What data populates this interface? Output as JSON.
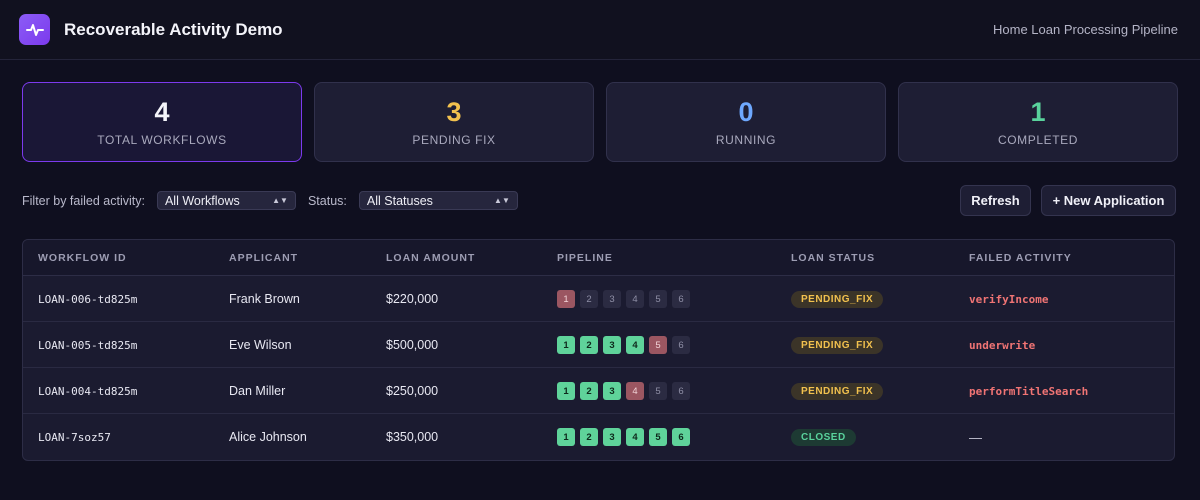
{
  "header": {
    "title": "Recoverable Activity Demo",
    "subtitle": "Home Loan Processing Pipeline",
    "logo_icon": "activity-pulse-icon"
  },
  "stats": [
    {
      "value": "4",
      "label": "TOTAL WORKFLOWS",
      "color": "#f4f4fa"
    },
    {
      "value": "3",
      "label": "PENDING FIX",
      "color": "#f2c14e"
    },
    {
      "value": "0",
      "label": "RUNNING",
      "color": "#6ea8fe"
    },
    {
      "value": "1",
      "label": "COMPLETED",
      "color": "#59d29c"
    }
  ],
  "filters": {
    "failed_label": "Filter by failed activity:",
    "failed_value": "All Workflows",
    "status_label": "Status:",
    "status_value": "All Statuses",
    "refresh": "Refresh",
    "new_application": "+ New Application"
  },
  "table": {
    "columns": [
      "WORKFLOW ID",
      "APPLICANT",
      "LOAN AMOUNT",
      "PIPELINE",
      "LOAN STATUS",
      "FAILED ACTIVITY"
    ],
    "rows": [
      {
        "id": "LOAN-006-td825m",
        "applicant": "Frank Brown",
        "amount": "$220,000",
        "pipeline": [
          "fail",
          "todo",
          "todo",
          "todo",
          "todo",
          "todo"
        ],
        "status": "PENDING_FIX",
        "status_kind": "pending",
        "failed": "verifyIncome"
      },
      {
        "id": "LOAN-005-td825m",
        "applicant": "Eve Wilson",
        "amount": "$500,000",
        "pipeline": [
          "done",
          "done",
          "done",
          "done",
          "fail",
          "todo"
        ],
        "status": "PENDING_FIX",
        "status_kind": "pending",
        "failed": "underwrite"
      },
      {
        "id": "LOAN-004-td825m",
        "applicant": "Dan Miller",
        "amount": "$250,000",
        "pipeline": [
          "done",
          "done",
          "done",
          "fail",
          "todo",
          "todo"
        ],
        "status": "PENDING_FIX",
        "status_kind": "pending",
        "failed": "performTitleSearch"
      },
      {
        "id": "LOAN-7soz57",
        "applicant": "Alice Johnson",
        "amount": "$350,000",
        "pipeline": [
          "done",
          "done",
          "done",
          "done",
          "done",
          "done"
        ],
        "status": "CLOSED",
        "status_kind": "closed",
        "failed": "—"
      }
    ]
  }
}
